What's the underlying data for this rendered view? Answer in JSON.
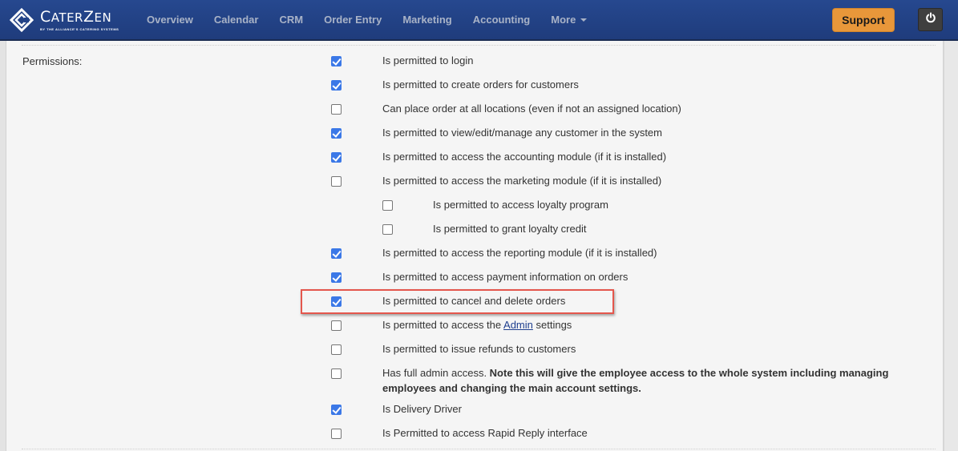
{
  "app": {
    "brand": "CaterZen",
    "brand_tagline": "BY THE ALLIANCE'S CATERING SYSTEMS"
  },
  "nav": {
    "items": [
      {
        "label": "Overview"
      },
      {
        "label": "Calendar"
      },
      {
        "label": "CRM"
      },
      {
        "label": "Order Entry"
      },
      {
        "label": "Marketing"
      },
      {
        "label": "Accounting"
      },
      {
        "label": "More"
      }
    ],
    "support_label": "Support",
    "power_icon": "power-icon"
  },
  "colors": {
    "navbar": "#26488f",
    "support": "#e8973a",
    "checkbox_checked": "#3b78e7",
    "highlight": "#e4574d"
  },
  "permissions": {
    "label": "Permissions:",
    "items": [
      {
        "text": "Is permitted to login",
        "checked": true,
        "indent": false
      },
      {
        "text": "Is permitted to create orders for customers",
        "checked": true,
        "indent": false
      },
      {
        "text": "Can place order at all locations (even if not an assigned location)",
        "checked": false,
        "indent": false
      },
      {
        "text": "Is permitted to view/edit/manage any customer in the system",
        "checked": true,
        "indent": false
      },
      {
        "text": "Is permitted to access the accounting module (if it is installed)",
        "checked": true,
        "indent": false
      },
      {
        "text": "Is permitted to access the marketing module (if it is installed)",
        "checked": false,
        "indent": false
      },
      {
        "text": "Is permitted to access loyalty program",
        "checked": false,
        "indent": true
      },
      {
        "text": "Is permitted to grant loyalty credit",
        "checked": false,
        "indent": true
      },
      {
        "text": "Is permitted to access the reporting module (if it is installed)",
        "checked": true,
        "indent": false
      },
      {
        "text": "Is permitted to access payment information on orders",
        "checked": true,
        "indent": false
      },
      {
        "text": "Is permitted to cancel and delete orders",
        "checked": true,
        "indent": false,
        "highlighted": true
      },
      {
        "text_before": "Is permitted to access the ",
        "link": "Admin",
        "text_after": " settings",
        "checked": false,
        "indent": false
      },
      {
        "text": "Is permitted to issue refunds to customers",
        "checked": false,
        "indent": false
      },
      {
        "text": "Has full admin access. ",
        "bold": "Note this will give the employee access to the whole system including managing employees and changing the main account settings.",
        "checked": false,
        "indent": false
      },
      {
        "text": "Is Delivery Driver",
        "checked": true,
        "indent": false
      },
      {
        "text": "Is Permitted to access Rapid Reply interface",
        "checked": false,
        "indent": false
      }
    ]
  }
}
